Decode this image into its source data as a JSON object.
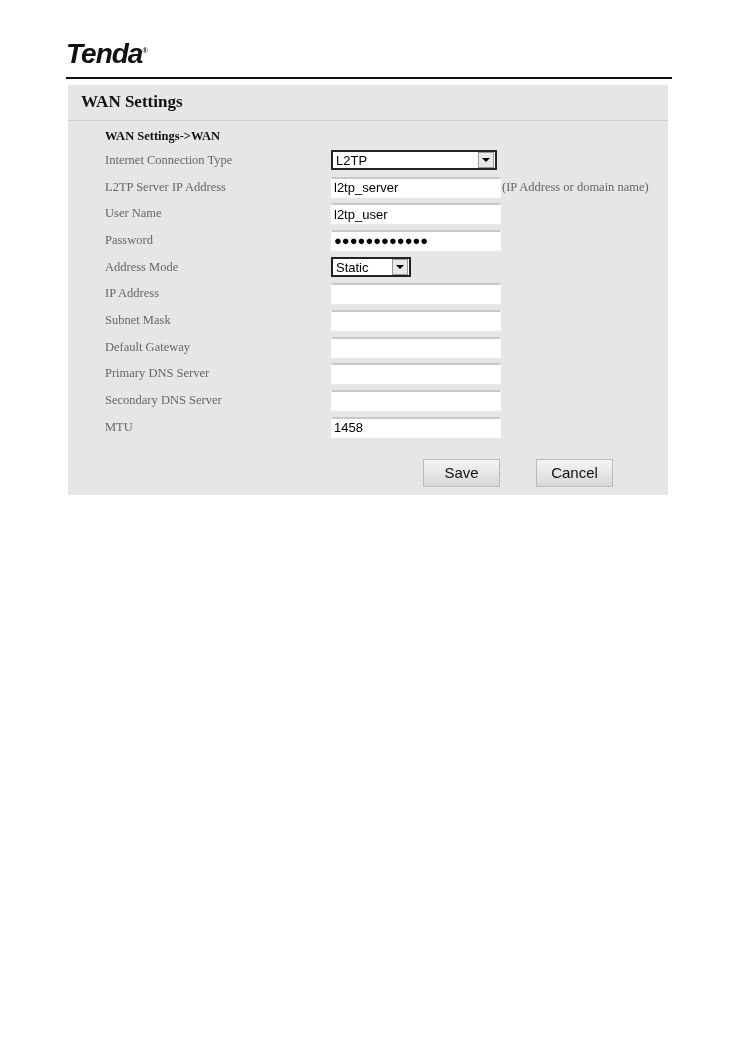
{
  "header": {
    "logo": "Tenda$^{®}$"
  },
  "panel": {
    "title": "WAN Settings",
    "subtitle": "WAN Settings->WAN",
    "fields": [
      {
        "kind": "select",
        "label": "Internet Connection Type",
        "value": "L2TP"
      },
      {
        "kind": "text",
        "label": "L2TP Server IP Address",
        "value": "l2tp_server",
        "hint": "(IP Address or domain name)"
      },
      {
        "kind": "text",
        "label": "User Name",
        "value": "l2tp_user"
      },
      {
        "kind": "text",
        "label": "Password",
        "value": "●●●●●●●●●●●●"
      },
      {
        "kind": "miniselect",
        "label": "Address Mode",
        "value": "Static"
      },
      {
        "kind": "text",
        "label": "IP Address"
      },
      {
        "kind": "text",
        "label": "Subnet Mask"
      },
      {
        "kind": "text",
        "label": "Default Gateway"
      },
      {
        "kind": "text",
        "label": "Primary DNS Server"
      },
      {
        "kind": "text",
        "label": "Secondary DNS Server"
      },
      {
        "kind": "text",
        "label": "MTU",
        "value": "1458"
      }
    ],
    "buttons": [
      "Save",
      "Cancel"
    ]
  }
}
